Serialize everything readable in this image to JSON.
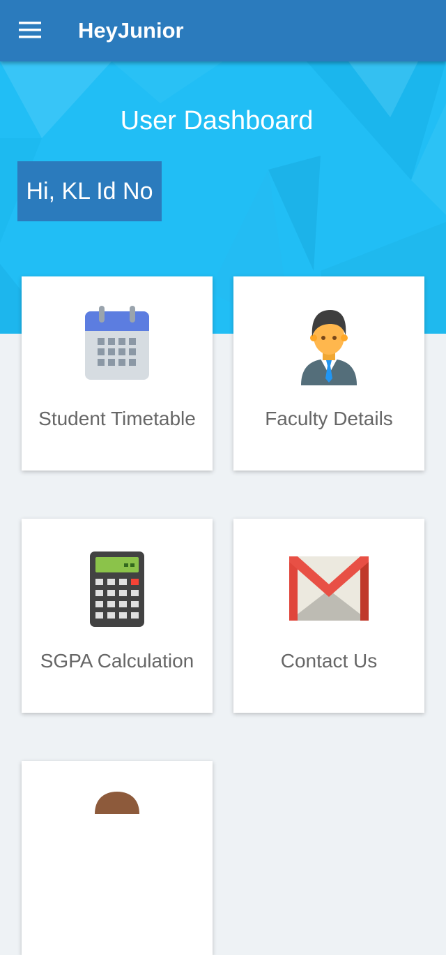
{
  "appbar": {
    "title": "HeyJunior",
    "menu_icon": "hamburger-menu-icon"
  },
  "hero": {
    "title": "User Dashboard",
    "greeting": "Hi, KL Id No"
  },
  "colors": {
    "primary": "#2b7bbd",
    "hero": "#21bef5",
    "background": "#eef2f5",
    "card": "#ffffff",
    "label": "#666666"
  },
  "cards": [
    {
      "label": "Student Timetable",
      "icon": "calendar-icon"
    },
    {
      "label": "Faculty Details",
      "icon": "faculty-person-icon"
    },
    {
      "label": "SGPA Calculation",
      "icon": "calculator-icon"
    },
    {
      "label": "Contact Us",
      "icon": "gmail-icon"
    },
    {
      "label": "",
      "icon": "profile-person-icon"
    }
  ]
}
